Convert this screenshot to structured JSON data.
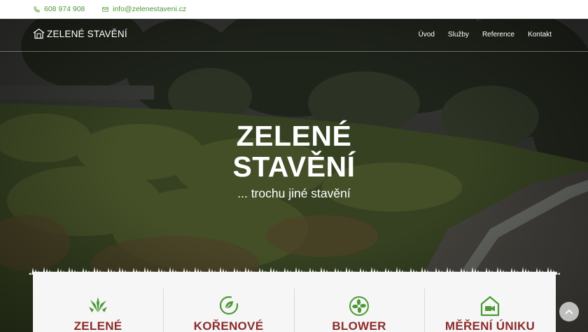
{
  "topbar": {
    "phone": "608 974 908",
    "email": "info@zelenestaveni.cz"
  },
  "nav": {
    "logo_text": "ZELENÉ STAVĚNÍ",
    "items": [
      {
        "label": "Úvod"
      },
      {
        "label": "Služby"
      },
      {
        "label": "Reference"
      },
      {
        "label": "Kontakt"
      }
    ]
  },
  "hero": {
    "title_line1": "ZELENÉ",
    "title_line2": "STAVĚNÍ",
    "subtitle": "... trochu jiné stavění"
  },
  "services": [
    {
      "title": "ZELENÉ",
      "icon": "grass-icon"
    },
    {
      "title": "KOŘENOVÉ",
      "icon": "recycle-leaf-icon"
    },
    {
      "title": "BLOWER",
      "icon": "fan-icon"
    },
    {
      "title": "MĚŘENÍ ÚNIKU",
      "icon": "house-camera-icon"
    }
  ],
  "colors": {
    "accent_green": "#4b9a35",
    "service_title": "#8e2b2b"
  }
}
